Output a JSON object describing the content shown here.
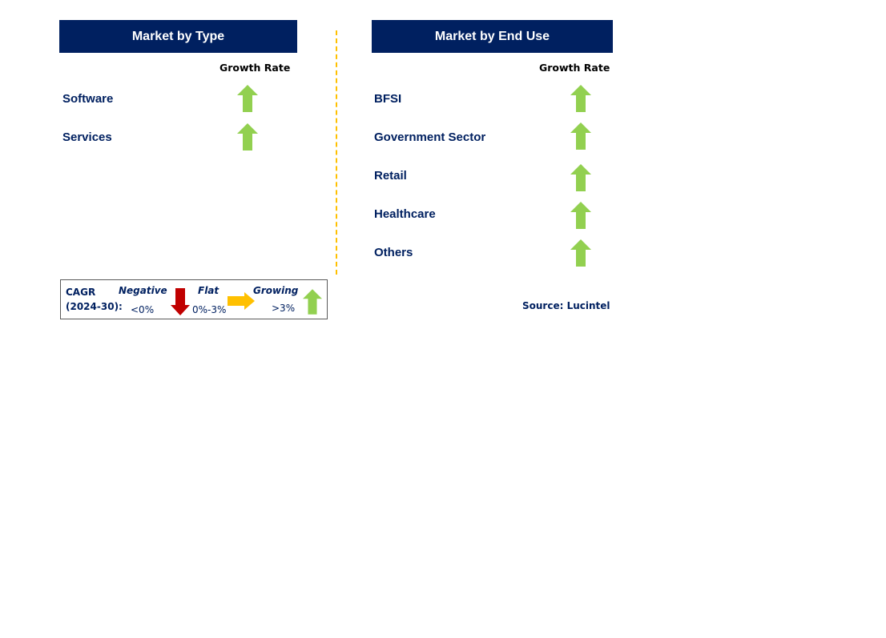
{
  "left_panel": {
    "title": "Market by Type",
    "growth_header": "Growth Rate",
    "items": [
      {
        "label": "Software",
        "trend": "growing"
      },
      {
        "label": "Services",
        "trend": "growing"
      }
    ]
  },
  "right_panel": {
    "title": "Market by End Use",
    "growth_header": "Growth Rate",
    "items": [
      {
        "label": "BFSI",
        "trend": "growing"
      },
      {
        "label": "Government Sector",
        "trend": "growing"
      },
      {
        "label": "Retail",
        "trend": "growing"
      },
      {
        "label": "Healthcare",
        "trend": "growing"
      },
      {
        "label": "Others",
        "trend": "growing"
      }
    ]
  },
  "legend": {
    "cagr_label": "CAGR",
    "period_label": "(2024-30):",
    "negative": {
      "label": "Negative",
      "range": "<0%"
    },
    "flat": {
      "label": "Flat",
      "range": "0%-3%"
    },
    "growing": {
      "label": "Growing",
      "range": ">3%"
    }
  },
  "source": "Source: Lucintel",
  "colors": {
    "header_bg": "#002060",
    "growing": "#92d050",
    "negative": "#c00000",
    "flat": "#ffc000",
    "divider": "#ffc000"
  }
}
